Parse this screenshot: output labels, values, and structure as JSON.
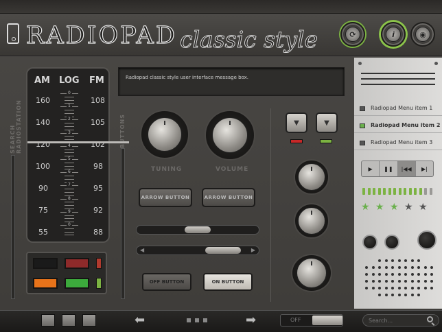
{
  "header": {
    "title": "RADIOPAD",
    "subtitle": "classic style"
  },
  "sidebar": {
    "search_label": "SEARCH RADIOSTATION",
    "buttons_label": "BUTTONS"
  },
  "tuner": {
    "am_label": "AM",
    "log_label": "LOG",
    "fm_label": "FM",
    "am_values": [
      "160",
      "140",
      "120",
      "100",
      "90",
      "75",
      "55"
    ],
    "fm_values": [
      "108",
      "105",
      "102",
      "98",
      "95",
      "92",
      "88"
    ],
    "log_values": [
      "0",
      "1",
      "2",
      "3",
      "4",
      "5",
      "6",
      "7",
      "8",
      "9",
      "0"
    ]
  },
  "message_box": {
    "text": "Radiopad classic style user interface message box."
  },
  "knobs": {
    "tuning_label": "TUNING",
    "volume_label": "VOLUME"
  },
  "buttons": {
    "arrow_left_label": "ARROW BUTTON",
    "arrow_right_label": "ARROW BUTTON",
    "off_label": "OFF BUTTON",
    "on_label": "ON BUTTON"
  },
  "menu": {
    "items": [
      {
        "label": "Radiopad Menu item 1",
        "active": false
      },
      {
        "label": "Radiopad Menu item 2",
        "active": true
      },
      {
        "label": "Radiopad Menu item 3",
        "active": false
      }
    ]
  },
  "player": {
    "controls": [
      "play-icon",
      "pause-icon",
      "skip-back-icon",
      "skip-forward-icon"
    ],
    "active_index": 2
  },
  "rating": {
    "value": 3,
    "max": 5
  },
  "equalizer": {
    "level": 0.85
  },
  "footer": {
    "toggle_label": "OFF",
    "search_placeholder": "Search..."
  },
  "colors": {
    "accent_green": "#7cb342",
    "led_red": "#c62828",
    "led_green": "#7cb342",
    "swatch_black": "#1a1a1a",
    "swatch_red": "#8e2a2a",
    "swatch_orange": "#e8731a",
    "swatch_green": "#3caa3c"
  }
}
